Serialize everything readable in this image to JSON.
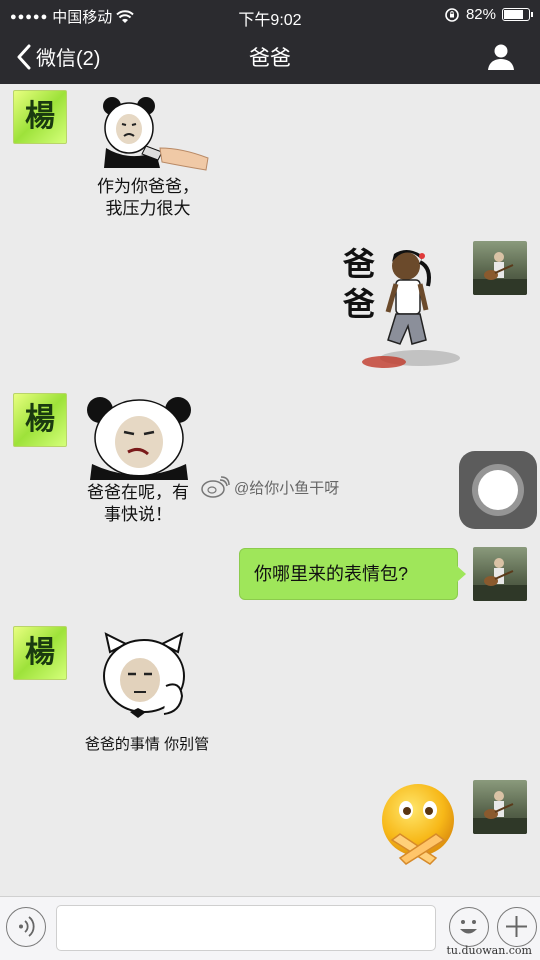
{
  "status_bar": {
    "signal": "●●●●●",
    "carrier": "中国移动",
    "time": "下午9:02",
    "battery_percent_text": "82%",
    "battery_level": 0.82
  },
  "nav": {
    "back_label": "微信(2)",
    "title": "爸爸"
  },
  "messages": [
    {
      "sender": "other",
      "avatar_text": "楊",
      "type": "sticker",
      "caption_lines": [
        "作为你爸爸，",
        "我压力很大"
      ]
    },
    {
      "sender": "me",
      "type": "sticker",
      "sticker_text": [
        "爸",
        "爸"
      ]
    },
    {
      "sender": "other",
      "avatar_text": "楊",
      "type": "sticker",
      "caption_lines": [
        "爸爸在呢，有",
        "事快说！"
      ]
    },
    {
      "sender": "me",
      "type": "text",
      "text": "你哪里来的表情包?"
    },
    {
      "sender": "other",
      "avatar_text": "楊",
      "type": "sticker",
      "caption_lines": [
        "爸爸的事情 你别管"
      ]
    },
    {
      "sender": "me",
      "type": "sticker",
      "sticker_icon": "shush-emoji-icon"
    }
  ],
  "watermark": "@给你小鱼干呀",
  "input_bar": {
    "placeholder": "",
    "site_mark": "tu.duowan.com"
  },
  "colors": {
    "nav_bg": "#2b2b2f",
    "chat_bg": "#ebebeb",
    "sent_bubble": "#9fe65a"
  }
}
